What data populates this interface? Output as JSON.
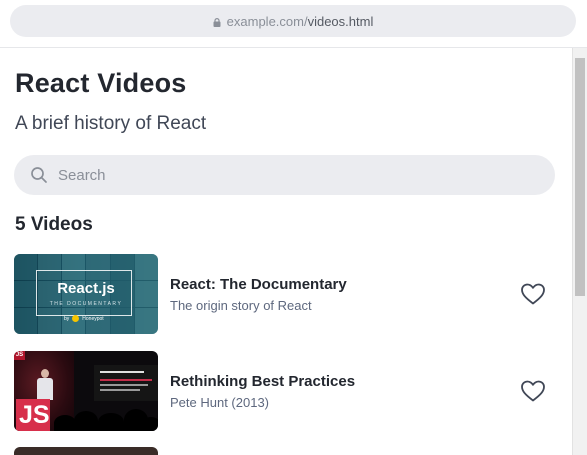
{
  "browser": {
    "url_host": "example.com/",
    "url_path": "videos.html"
  },
  "page": {
    "title": "React Videos",
    "subtitle": "A brief history of React"
  },
  "search": {
    "placeholder": "Search"
  },
  "videos_count_label": "5 Videos",
  "videos": [
    {
      "title": "React: The Documentary",
      "description": "The origin story of React",
      "thumbnail": {
        "logo_text": "React.js",
        "subtitle_text": "THE DOCUMENTARY",
        "by_text": "by",
        "brand_text": "Honeypot"
      }
    },
    {
      "title": "Rethinking Best Practices",
      "description": "Pete Hunt (2013)",
      "thumbnail": {
        "badge_text": "JS",
        "big_text": "JS"
      }
    }
  ],
  "colors": {
    "accent": "#23272f",
    "muted": "#5e687e",
    "search_bg": "#ebecf0"
  }
}
